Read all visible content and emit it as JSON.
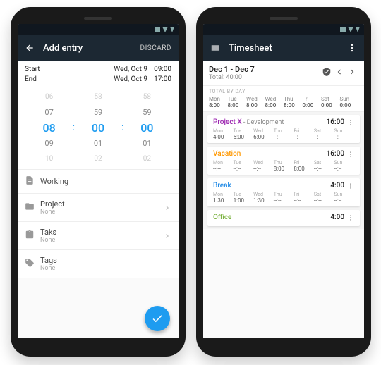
{
  "left": {
    "title": "Add entry",
    "discard": "DISCARD",
    "start_lbl": "Start",
    "end_lbl": "End",
    "start_date": "Wed, Oct 9",
    "start_time": "09:00",
    "end_date": "Wed, Oct 9",
    "end_time": "17:00",
    "picker": {
      "r0": {
        "h": "06",
        "m": "58",
        "s": "58"
      },
      "r1": {
        "h": "07",
        "m": "59",
        "s": "59"
      },
      "r2": {
        "h": "08",
        "m": "00",
        "s": "00"
      },
      "r3": {
        "h": "09",
        "m": "01",
        "s": "01"
      },
      "r4": {
        "h": "10",
        "m": "02",
        "s": "02"
      }
    },
    "working": "Working",
    "project_lbl": "Project",
    "project_val": "None",
    "task_lbl": "Taks",
    "task_val": "None",
    "tags_lbl": "Tags",
    "tags_val": "None"
  },
  "right": {
    "title": "Timesheet",
    "range": "Dec 1 - Dec 7",
    "total": "Total: 40:00",
    "section": "TOTAL BY DAY",
    "days": [
      {
        "d": "Mon",
        "v": "8:00"
      },
      {
        "d": "Tue",
        "v": "8:00"
      },
      {
        "d": "Wed",
        "v": "8:00"
      },
      {
        "d": "Wed",
        "v": "8:00"
      },
      {
        "d": "Thu",
        "v": "8:00"
      },
      {
        "d": "Fri",
        "v": "0:00"
      },
      {
        "d": "Sat",
        "v": "0:00"
      },
      {
        "d": "Sun",
        "v": "0:00"
      }
    ],
    "cards": [
      {
        "name": "Project X",
        "suffix": " - Development",
        "color": "#9c27b0",
        "total": "16:00",
        "days": [
          {
            "d": "Mon",
            "v": "4:00"
          },
          {
            "d": "Tue",
            "v": "6:00"
          },
          {
            "d": "Wed",
            "v": "6:00"
          },
          {
            "d": "Thu",
            "v": "--:--"
          },
          {
            "d": "Fri",
            "v": "--:--"
          },
          {
            "d": "Sat",
            "v": "--:--"
          },
          {
            "d": "Sun",
            "v": "--:--"
          }
        ]
      },
      {
        "name": "Vacation",
        "suffix": "",
        "color": "#ff9800",
        "total": "16:00",
        "days": [
          {
            "d": "Mon",
            "v": "--:--"
          },
          {
            "d": "Tue",
            "v": "--:--"
          },
          {
            "d": "Wed",
            "v": "--:--"
          },
          {
            "d": "Thu",
            "v": "8:00"
          },
          {
            "d": "Fri",
            "v": "8:00"
          },
          {
            "d": "Sat",
            "v": "--:--"
          },
          {
            "d": "Sun",
            "v": "--:--"
          }
        ]
      },
      {
        "name": "Break",
        "suffix": "",
        "color": "#1e88e5",
        "total": "4:00",
        "days": [
          {
            "d": "Mon",
            "v": "1:30"
          },
          {
            "d": "Tue",
            "v": "1:00"
          },
          {
            "d": "Wed",
            "v": "1:30"
          },
          {
            "d": "Thu",
            "v": "--:--"
          },
          {
            "d": "Fri",
            "v": "--:--"
          },
          {
            "d": "Sat",
            "v": "--:--"
          },
          {
            "d": "Sun",
            "v": "--:--"
          }
        ]
      },
      {
        "name": "Office",
        "suffix": "",
        "color": "#7cb342",
        "total": "4:00",
        "days": []
      }
    ]
  }
}
